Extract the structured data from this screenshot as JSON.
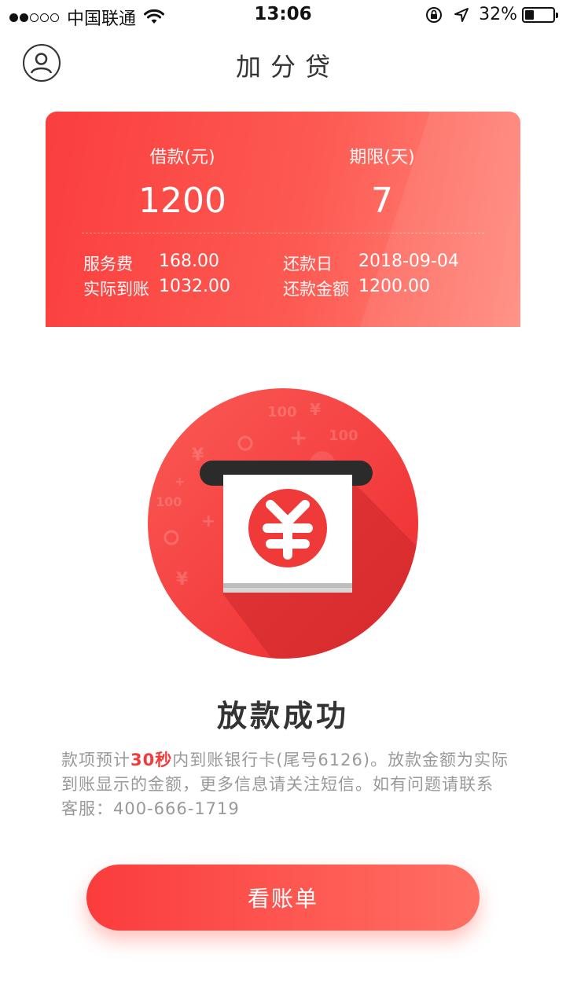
{
  "status_bar": {
    "carrier": "中国联通",
    "time": "13:06",
    "battery_text": "32%",
    "battery_level": 0.32,
    "signal_bars_filled": 2,
    "signal_bars_total": 5
  },
  "header": {
    "title": "加分贷",
    "profile_icon": "user-circle-icon"
  },
  "loan_card": {
    "amount_label": "借款(元)",
    "amount_value": "1200",
    "term_label": "期限(天)",
    "term_value": "7",
    "service_fee_label": "服务费",
    "service_fee_value": "168.00",
    "actual_received_label": "实际到账",
    "actual_received_value": "1032.00",
    "repay_date_label": "还款日",
    "repay_date_value": "2018-09-04",
    "repay_amount_label": "还款金额",
    "repay_amount_value": "1200.00",
    "accent_color": "#fb3e3e"
  },
  "illustration": {
    "icon": "yuan-receipt-icon",
    "circle_color": "#f2383a"
  },
  "result": {
    "title": "放款成功",
    "desc_prefix": "款项预计",
    "desc_highlight": "30秒",
    "desc_suffix": "内到账银行卡(尾号6126)。放款金额为实际到账显示的金额，更多信息请关注短信。如有问题请联系客服：400-666-1719",
    "highlight_color": "#f23b3b"
  },
  "actions": {
    "view_bill_label": "看账单"
  }
}
